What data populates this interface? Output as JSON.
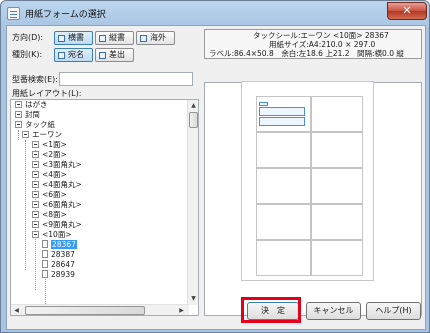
{
  "window": {
    "title": "用紙フォームの選択",
    "close_glyph": "✕"
  },
  "orientation": {
    "label": "方向(D):",
    "options": [
      {
        "label": "横書",
        "selected": true
      },
      {
        "label": "縦書",
        "selected": false
      },
      {
        "label": "海外",
        "selected": false
      }
    ]
  },
  "kind": {
    "label": "種別(K):",
    "options": [
      {
        "label": "宛名",
        "selected": true
      },
      {
        "label": "差出",
        "selected": false
      }
    ]
  },
  "info": {
    "line1": "タックシール:エーワン <10面> 28367",
    "line2": "用紙サイズ:A4:210.0 × 297.0",
    "line3": "ラベル:86.4×50.8　余白:左18.6 上21.2　間隔:横0.0 縦"
  },
  "model_search": {
    "label": "型番検索(E):",
    "value": ""
  },
  "layout": {
    "label": "用紙レイアウト(L):"
  },
  "tree": [
    {
      "label": "はがき",
      "type": "folder"
    },
    {
      "label": "封筒",
      "type": "folder"
    },
    {
      "label": "タック紙",
      "type": "folder"
    },
    {
      "label": "エーワン",
      "type": "folder"
    },
    {
      "label": "<1面>",
      "type": "folder"
    },
    {
      "label": "<2面>",
      "type": "folder"
    },
    {
      "label": "<3面角丸>",
      "type": "folder"
    },
    {
      "label": "<4面>",
      "type": "folder"
    },
    {
      "label": "<4面角丸>",
      "type": "folder"
    },
    {
      "label": "<6面>",
      "type": "folder"
    },
    {
      "label": "<6面角丸>",
      "type": "folder"
    },
    {
      "label": "<8面>",
      "type": "folder"
    },
    {
      "label": "<9面角丸>",
      "type": "folder"
    },
    {
      "label": "<10面>",
      "type": "folder"
    },
    {
      "label": "28367",
      "type": "doc",
      "selected": true
    },
    {
      "label": "28387",
      "type": "doc"
    },
    {
      "label": "28647",
      "type": "doc"
    },
    {
      "label": "28939",
      "type": "doc"
    }
  ],
  "buttons": {
    "ok": "決　定",
    "cancel": "キャンセル",
    "help": "ヘルプ(H)"
  },
  "colors": {
    "highlight": "#e4001b",
    "selection": "#3399ff"
  }
}
